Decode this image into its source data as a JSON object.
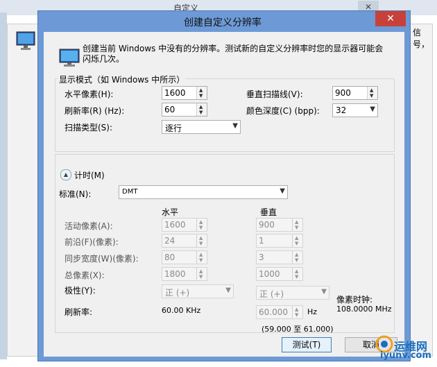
{
  "background_window": {
    "title": "自定义",
    "close_glyph": "✕",
    "right_text": "信号，"
  },
  "dialog": {
    "title": "创建自定义分辨率",
    "close_glyph": "✕",
    "intro": "创建当前 Windows 中没有的分辨率。测试新的自定义分辨率时您的显示器可能会闪烁几次。",
    "display_mode": {
      "group_label": "显示模式（如 Windows 中所示）",
      "h_pixels_label": "水平像素(H):",
      "h_pixels_value": "1600",
      "v_lines_label": "垂直扫描线(V):",
      "v_lines_value": "900",
      "refresh_label": "刷新率(R) (Hz):",
      "refresh_value": "60",
      "color_depth_label": "颜色深度(C) (bpp):",
      "color_depth_value": "32",
      "scan_type_label": "扫描类型(S):",
      "scan_type_value": "逐行"
    },
    "timing": {
      "section_label": "计时(M)",
      "expand_glyph": "▲",
      "standard_label": "标准(N):",
      "standard_value": "DMT",
      "col_horizontal": "水平",
      "col_vertical": "垂直",
      "rows": {
        "active_pixels": {
          "label": "活动像素(A):",
          "h": "1600",
          "v": "900"
        },
        "front_porch": {
          "label": "前沿(F)(像素):",
          "h": "24",
          "v": "1"
        },
        "sync_width": {
          "label": "同步宽度(W)(像素):",
          "h": "80",
          "v": "3"
        },
        "total_pixels": {
          "label": "总像素(X):",
          "h": "1800",
          "v": "1000"
        }
      },
      "polarity_label": "极性(Y):",
      "polarity_h": "正 (+)",
      "polarity_v": "正 (+)",
      "pixel_clock_label": "像素时钟:",
      "pixel_clock_value": "108.0000 MHz",
      "refresh_label": "刷新率:",
      "refresh_h": "60.00 KHz",
      "refresh_v": "60.000",
      "refresh_unit": "Hz",
      "refresh_range": "(59.000 至 61.000)"
    },
    "buttons": {
      "test": "测试(T)",
      "cancel": "取消"
    }
  },
  "watermark": {
    "line1": "运维网",
    "line2": "iyunv.com"
  },
  "colors": {
    "titlebar": "#6d9ad6",
    "close": "#c7413a",
    "client": "#f0f0f0"
  }
}
